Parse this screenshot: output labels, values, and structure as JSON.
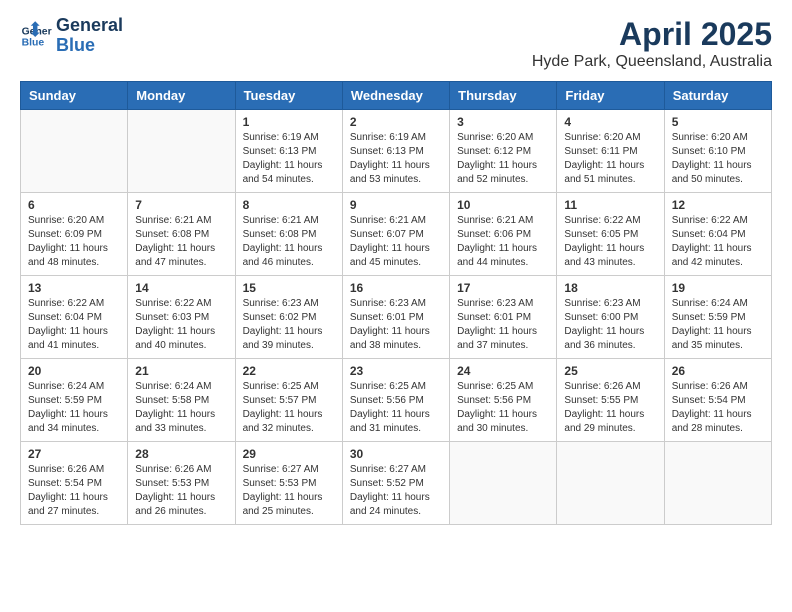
{
  "header": {
    "logo_line1": "General",
    "logo_line2": "Blue",
    "month": "April 2025",
    "location": "Hyde Park, Queensland, Australia"
  },
  "weekdays": [
    "Sunday",
    "Monday",
    "Tuesday",
    "Wednesday",
    "Thursday",
    "Friday",
    "Saturday"
  ],
  "weeks": [
    [
      {
        "day": "",
        "info": ""
      },
      {
        "day": "",
        "info": ""
      },
      {
        "day": "1",
        "info": "Sunrise: 6:19 AM\nSunset: 6:13 PM\nDaylight: 11 hours and 54 minutes."
      },
      {
        "day": "2",
        "info": "Sunrise: 6:19 AM\nSunset: 6:13 PM\nDaylight: 11 hours and 53 minutes."
      },
      {
        "day": "3",
        "info": "Sunrise: 6:20 AM\nSunset: 6:12 PM\nDaylight: 11 hours and 52 minutes."
      },
      {
        "day": "4",
        "info": "Sunrise: 6:20 AM\nSunset: 6:11 PM\nDaylight: 11 hours and 51 minutes."
      },
      {
        "day": "5",
        "info": "Sunrise: 6:20 AM\nSunset: 6:10 PM\nDaylight: 11 hours and 50 minutes."
      }
    ],
    [
      {
        "day": "6",
        "info": "Sunrise: 6:20 AM\nSunset: 6:09 PM\nDaylight: 11 hours and 48 minutes."
      },
      {
        "day": "7",
        "info": "Sunrise: 6:21 AM\nSunset: 6:08 PM\nDaylight: 11 hours and 47 minutes."
      },
      {
        "day": "8",
        "info": "Sunrise: 6:21 AM\nSunset: 6:08 PM\nDaylight: 11 hours and 46 minutes."
      },
      {
        "day": "9",
        "info": "Sunrise: 6:21 AM\nSunset: 6:07 PM\nDaylight: 11 hours and 45 minutes."
      },
      {
        "day": "10",
        "info": "Sunrise: 6:21 AM\nSunset: 6:06 PM\nDaylight: 11 hours and 44 minutes."
      },
      {
        "day": "11",
        "info": "Sunrise: 6:22 AM\nSunset: 6:05 PM\nDaylight: 11 hours and 43 minutes."
      },
      {
        "day": "12",
        "info": "Sunrise: 6:22 AM\nSunset: 6:04 PM\nDaylight: 11 hours and 42 minutes."
      }
    ],
    [
      {
        "day": "13",
        "info": "Sunrise: 6:22 AM\nSunset: 6:04 PM\nDaylight: 11 hours and 41 minutes."
      },
      {
        "day": "14",
        "info": "Sunrise: 6:22 AM\nSunset: 6:03 PM\nDaylight: 11 hours and 40 minutes."
      },
      {
        "day": "15",
        "info": "Sunrise: 6:23 AM\nSunset: 6:02 PM\nDaylight: 11 hours and 39 minutes."
      },
      {
        "day": "16",
        "info": "Sunrise: 6:23 AM\nSunset: 6:01 PM\nDaylight: 11 hours and 38 minutes."
      },
      {
        "day": "17",
        "info": "Sunrise: 6:23 AM\nSunset: 6:01 PM\nDaylight: 11 hours and 37 minutes."
      },
      {
        "day": "18",
        "info": "Sunrise: 6:23 AM\nSunset: 6:00 PM\nDaylight: 11 hours and 36 minutes."
      },
      {
        "day": "19",
        "info": "Sunrise: 6:24 AM\nSunset: 5:59 PM\nDaylight: 11 hours and 35 minutes."
      }
    ],
    [
      {
        "day": "20",
        "info": "Sunrise: 6:24 AM\nSunset: 5:59 PM\nDaylight: 11 hours and 34 minutes."
      },
      {
        "day": "21",
        "info": "Sunrise: 6:24 AM\nSunset: 5:58 PM\nDaylight: 11 hours and 33 minutes."
      },
      {
        "day": "22",
        "info": "Sunrise: 6:25 AM\nSunset: 5:57 PM\nDaylight: 11 hours and 32 minutes."
      },
      {
        "day": "23",
        "info": "Sunrise: 6:25 AM\nSunset: 5:56 PM\nDaylight: 11 hours and 31 minutes."
      },
      {
        "day": "24",
        "info": "Sunrise: 6:25 AM\nSunset: 5:56 PM\nDaylight: 11 hours and 30 minutes."
      },
      {
        "day": "25",
        "info": "Sunrise: 6:26 AM\nSunset: 5:55 PM\nDaylight: 11 hours and 29 minutes."
      },
      {
        "day": "26",
        "info": "Sunrise: 6:26 AM\nSunset: 5:54 PM\nDaylight: 11 hours and 28 minutes."
      }
    ],
    [
      {
        "day": "27",
        "info": "Sunrise: 6:26 AM\nSunset: 5:54 PM\nDaylight: 11 hours and 27 minutes."
      },
      {
        "day": "28",
        "info": "Sunrise: 6:26 AM\nSunset: 5:53 PM\nDaylight: 11 hours and 26 minutes."
      },
      {
        "day": "29",
        "info": "Sunrise: 6:27 AM\nSunset: 5:53 PM\nDaylight: 11 hours and 25 minutes."
      },
      {
        "day": "30",
        "info": "Sunrise: 6:27 AM\nSunset: 5:52 PM\nDaylight: 11 hours and 24 minutes."
      },
      {
        "day": "",
        "info": ""
      },
      {
        "day": "",
        "info": ""
      },
      {
        "day": "",
        "info": ""
      }
    ]
  ]
}
